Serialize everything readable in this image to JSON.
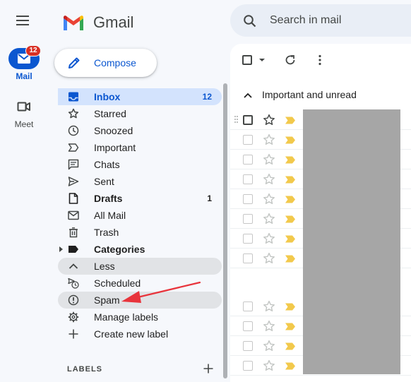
{
  "app": {
    "name": "Gmail"
  },
  "rail": {
    "mail": {
      "label": "Mail",
      "badge": "12"
    },
    "meet": {
      "label": "Meet"
    }
  },
  "compose": {
    "label": "Compose"
  },
  "search": {
    "placeholder": "Search in mail"
  },
  "nav": {
    "items": [
      {
        "label": "Inbox",
        "count": "12",
        "icon": "inbox-icon"
      },
      {
        "label": "Starred",
        "count": "",
        "icon": "star-icon"
      },
      {
        "label": "Snoozed",
        "count": "",
        "icon": "clock-icon"
      },
      {
        "label": "Important",
        "count": "",
        "icon": "important-icon"
      },
      {
        "label": "Chats",
        "count": "",
        "icon": "chat-icon"
      },
      {
        "label": "Sent",
        "count": "",
        "icon": "send-icon"
      },
      {
        "label": "Drafts",
        "count": "1",
        "icon": "draft-icon"
      },
      {
        "label": "All Mail",
        "count": "",
        "icon": "all-mail-icon"
      },
      {
        "label": "Trash",
        "count": "",
        "icon": "trash-icon"
      },
      {
        "label": "Categories",
        "count": "",
        "icon": "label-icon"
      },
      {
        "label": "Less",
        "count": "",
        "icon": "chevron-up-icon"
      },
      {
        "label": "Scheduled",
        "count": "",
        "icon": "scheduled-icon"
      },
      {
        "label": "Spam",
        "count": "",
        "icon": "spam-icon"
      },
      {
        "label": "Manage labels",
        "count": "",
        "icon": "gear-icon"
      },
      {
        "label": "Create new label",
        "count": "",
        "icon": "plus-icon"
      }
    ]
  },
  "labels_section": {
    "title": "LABELS"
  },
  "main": {
    "section_title": "Important and unread"
  },
  "colors": {
    "accent": "#0b57d0",
    "active_bg": "#d3e3fd",
    "badge": "#d93025",
    "important_marker": "#f2c94c",
    "annotation_arrow": "#e8343c"
  }
}
